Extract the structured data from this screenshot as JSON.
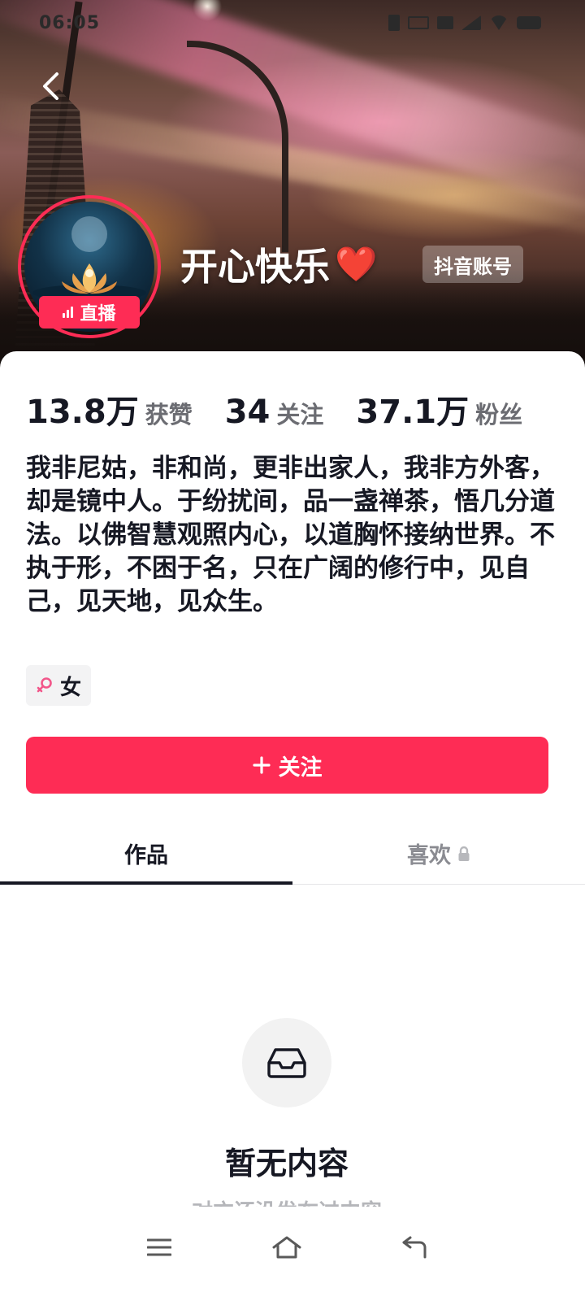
{
  "status_bar": {
    "time": "06:05"
  },
  "profile": {
    "nickname": "开心快乐",
    "nickname_emoji": "❤️",
    "account_tag": "抖音账号",
    "live_badge": "直播"
  },
  "stats": [
    {
      "value": "13.8万",
      "label": "获赞"
    },
    {
      "value": "34",
      "label": "关注"
    },
    {
      "value": "37.1万",
      "label": "粉丝"
    }
  ],
  "bio": "我非尼姑，非和尚，更非出家人，我非方外客，却是镜中人。于纷扰间，品一盏禅茶，悟几分道法。以佛智慧观照内心，以道胸怀接纳世界。不执于形，不困于名，只在广阔的修行中，见自己，见天地，见众生。",
  "gender_tag": "女",
  "follow_button": {
    "label": "关注",
    "icon": "plus-icon"
  },
  "tabs": [
    {
      "label": "作品",
      "active": true
    },
    {
      "label": "喜欢",
      "locked": true
    }
  ],
  "empty_state": {
    "title": "暂无内容",
    "subtitle": "对方还没发布过内容"
  },
  "colors": {
    "accent": "#fe2c55",
    "text": "#161823",
    "muted": "#8a8b91"
  }
}
